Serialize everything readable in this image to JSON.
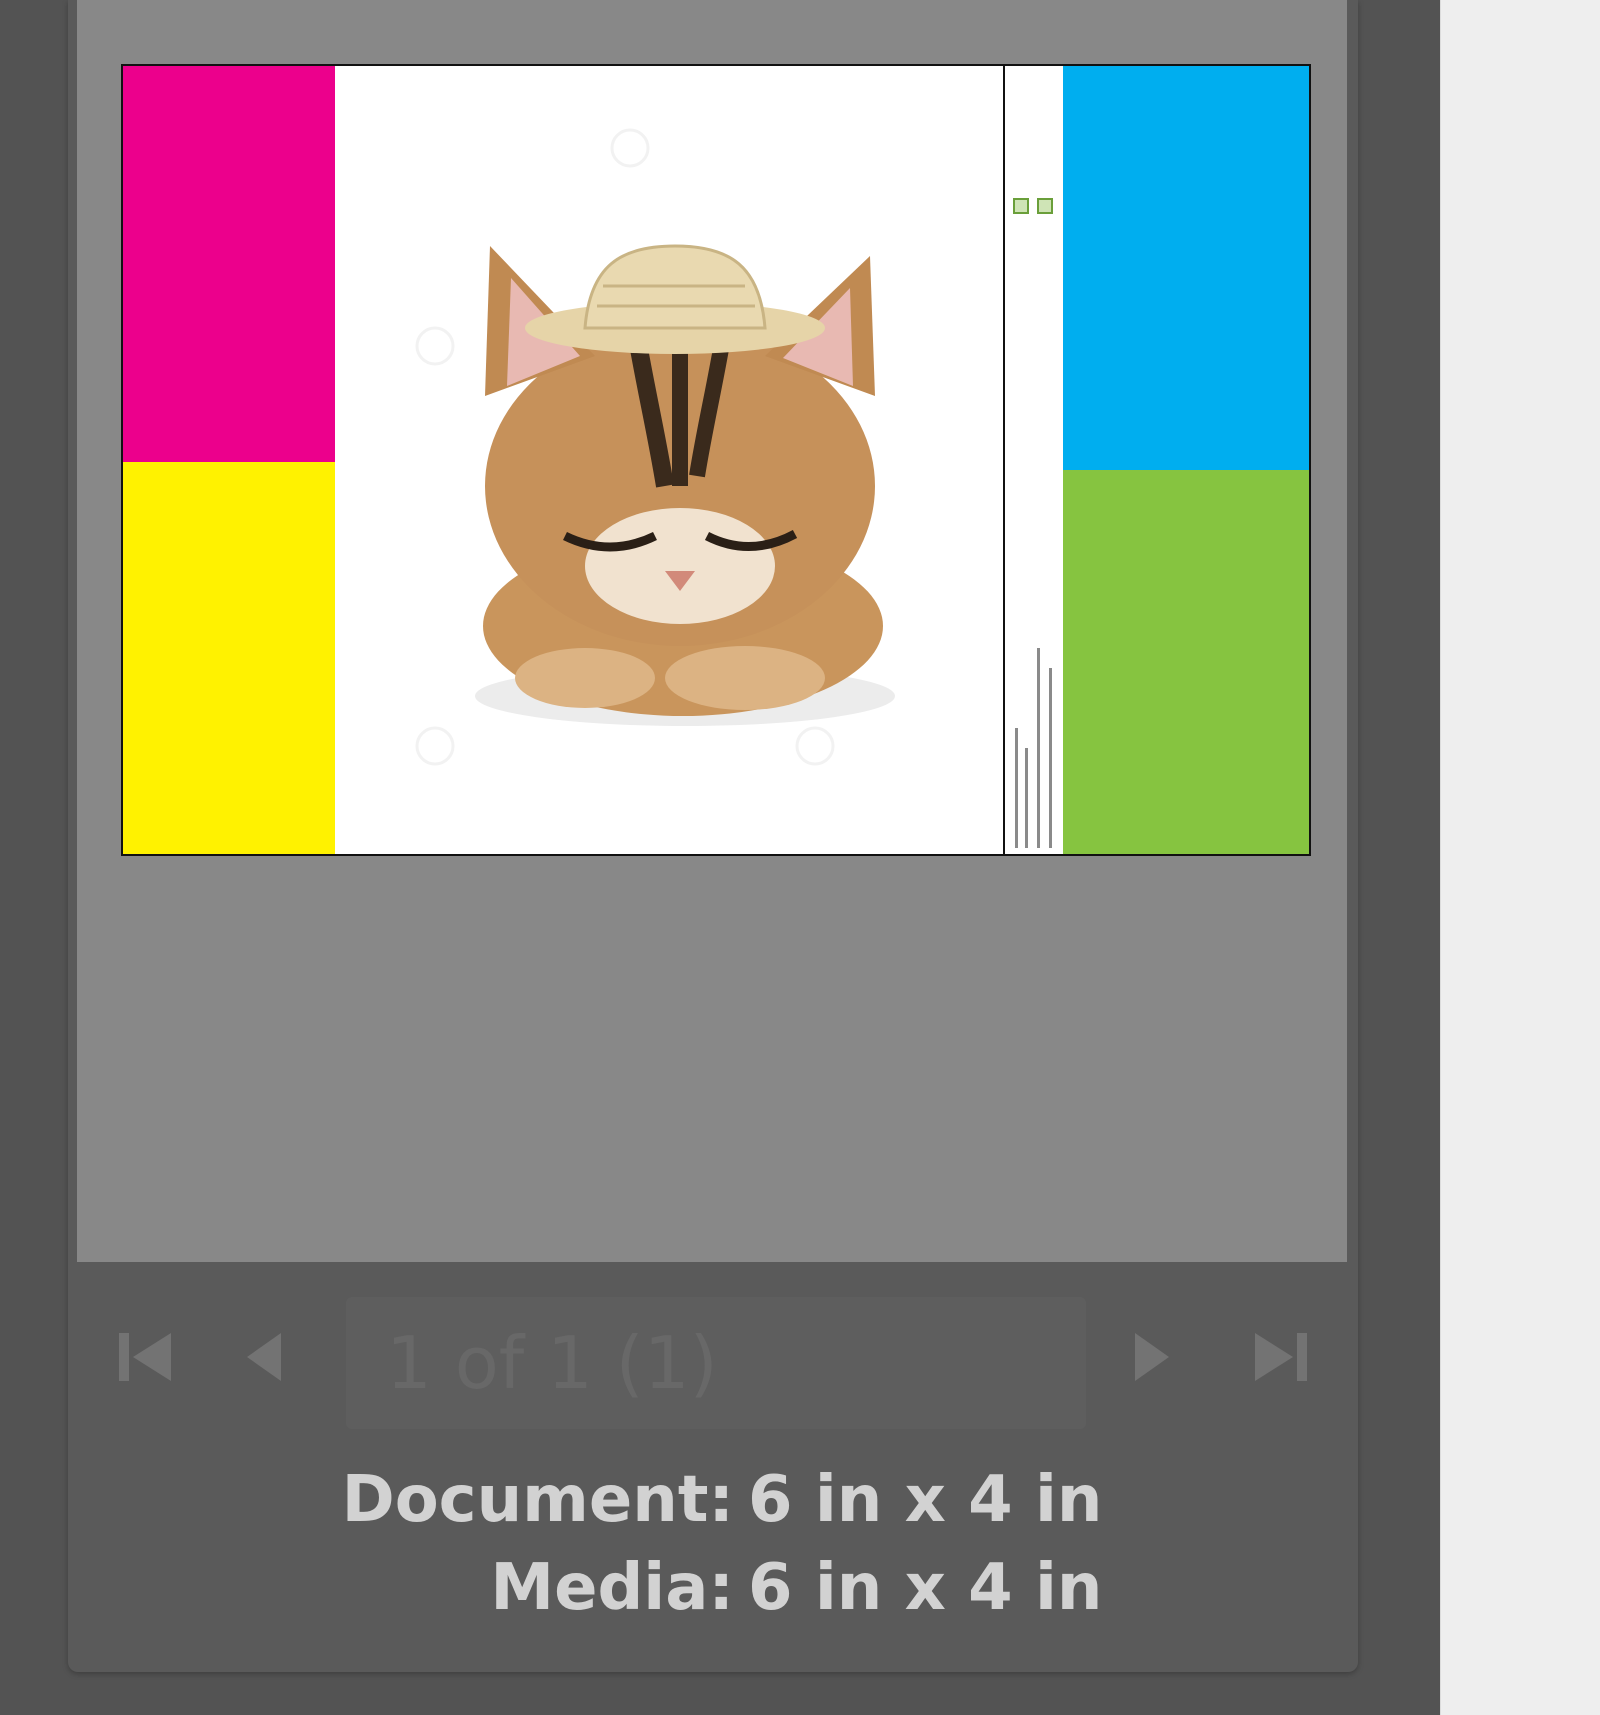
{
  "colors": {
    "background": "#535353",
    "canvas": "#888888",
    "magenta": "#ec008c",
    "yellow": "#fff200",
    "cyan": "#00aeef",
    "green": "#86c440"
  },
  "preview": {
    "image_subject": "kitten-with-straw-hat"
  },
  "navigation": {
    "first_icon": "first-page-icon",
    "prev_icon": "previous-page-icon",
    "page_indicator": "1 of 1 (1)",
    "next_icon": "next-page-icon",
    "last_icon": "last-page-icon"
  },
  "info": {
    "document_label": "Document:",
    "document_value": "6 in x 4 in",
    "media_label": "Media:",
    "media_value": "6 in x 4 in"
  }
}
